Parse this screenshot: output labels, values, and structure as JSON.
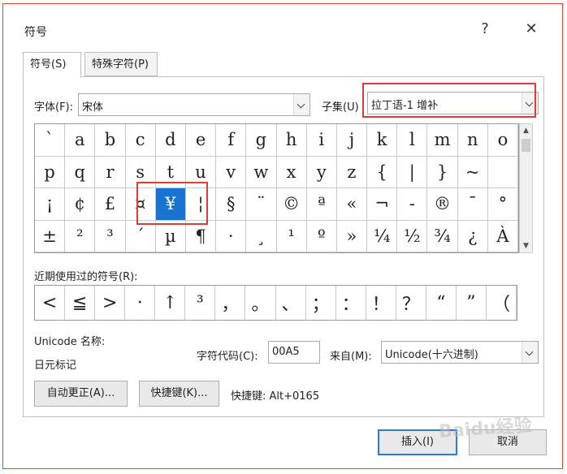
{
  "window": {
    "title": "符号",
    "help_glyph": "?",
    "close_glyph": "✕"
  },
  "tabs": [
    {
      "label": "符号(S)"
    },
    {
      "label": "特殊字符(P)"
    }
  ],
  "font": {
    "label": "字体(F):",
    "value": "宋体"
  },
  "subset": {
    "label": "子集(U)",
    "value": "拉丁语-1 增补"
  },
  "symbols": [
    "`",
    "a",
    "b",
    "c",
    "d",
    "e",
    "f",
    "g",
    "h",
    "i",
    "j",
    "k",
    "l",
    "m",
    "n",
    "o",
    "p",
    "q",
    "r",
    "s",
    "t",
    "u",
    "v",
    "w",
    "x",
    "y",
    "z",
    "{",
    "|",
    "}",
    "~",
    "",
    "¡",
    "¢",
    "£",
    "¤",
    "¥",
    "¦",
    "§",
    "¨",
    "©",
    "ª",
    "«",
    "¬",
    "-",
    "®",
    "¯",
    "°",
    "±",
    "²",
    "³",
    "´",
    "µ",
    "¶",
    "·",
    "¸",
    "¹",
    "º",
    "»",
    "¼",
    "½",
    "¾",
    "¿",
    "À"
  ],
  "selected_index": 36,
  "recent_label": "近期使用过的符号(R):",
  "recent_symbols": [
    "<",
    "≦",
    ">",
    "·",
    "↑",
    "³",
    "，",
    "。",
    "、",
    "；",
    "：",
    "！",
    "？",
    "“",
    "”",
    "（"
  ],
  "unicode_name_label": "Unicode 名称:",
  "unicode_name_value": "日元标记",
  "char_code": {
    "label": "字符代码(C):",
    "value": "00A5"
  },
  "from": {
    "label": "来自(M):",
    "value": "Unicode(十六进制)"
  },
  "buttons": {
    "autocorrect": "自动更正(A)...",
    "shortcut_key": "快捷键(K)...",
    "insert": "插入(I)",
    "cancel": "取消"
  },
  "shortcut_text": "快捷键: Alt+0165",
  "scroll_up": "▲",
  "scroll_down": "▼",
  "watermark": "Baidu经验",
  "colors": {
    "selection": "#1874d0",
    "highlight_box": "#e03a3a",
    "frame": "#d9463f",
    "primary_border": "#2b7ad6"
  }
}
